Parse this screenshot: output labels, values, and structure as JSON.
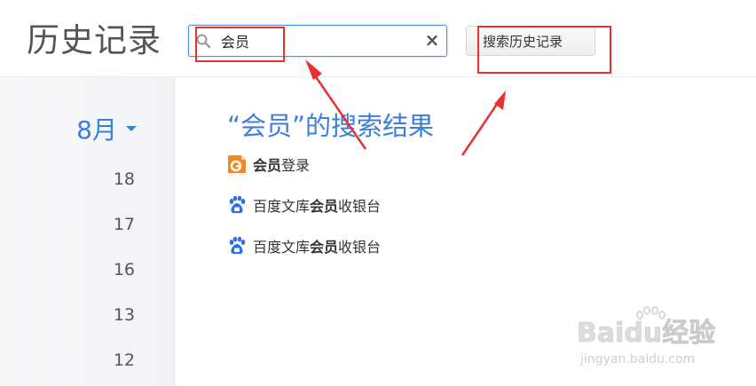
{
  "page": {
    "title": "历史记录"
  },
  "search": {
    "value": "会员",
    "clear_symbol": "×",
    "history_button_label": "搜索历史记录"
  },
  "sidebar": {
    "month_label": "8月",
    "days": [
      "18",
      "17",
      "16",
      "13",
      "12"
    ]
  },
  "results": {
    "heading": "“会员”的搜索结果",
    "items": [
      {
        "icon": "orange-site-icon",
        "parts": [
          "会员",
          "登录",
          ""
        ]
      },
      {
        "icon": "baidu-paw-icon",
        "parts": [
          "百度文库",
          "会员",
          "收银台"
        ]
      },
      {
        "icon": "baidu-paw-icon",
        "parts": [
          "百度文库",
          "会员",
          "收银台"
        ]
      }
    ]
  },
  "watermark": {
    "logo_text": "Baidu经验",
    "url_text": "jingyan.baidu.com"
  },
  "colors": {
    "accent": "#3c7fd9",
    "annotation_red": "#e8312f",
    "orange_icon": "#f08a24"
  }
}
